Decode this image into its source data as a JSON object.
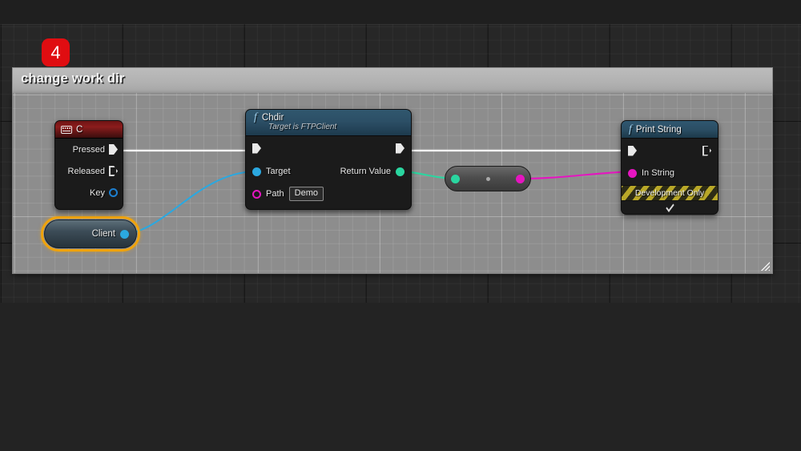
{
  "badge": {
    "number": "4"
  },
  "comment": {
    "title": "change work dir",
    "resize_handle_name": "resize-handle"
  },
  "colors": {
    "exec_white": "#e9e9e9",
    "object_blue": "#2ba8e0",
    "string_magenta": "#e515c0",
    "boolean_green": "#2ad6a0",
    "badge_red": "#e00d11",
    "selection_orange": "#f0a30a",
    "comment_bar": "#b2b2b2",
    "comment_body": "#8d8d8d"
  },
  "nodes": {
    "keyboard_event": {
      "icon": "keyboard-icon",
      "title": "C",
      "pins": [
        {
          "label": "Pressed",
          "type": "exec",
          "filled": true
        },
        {
          "label": "Released",
          "type": "exec",
          "filled": false
        },
        {
          "label": "Key",
          "type": "data",
          "color": "#1d7fd0"
        }
      ]
    },
    "chdir": {
      "icon": "function-icon",
      "title": "Chdir",
      "subtitle": "Target is FTPClient",
      "exec_in": "",
      "exec_out": "",
      "inputs": [
        {
          "label": "Target",
          "color": "#2ba8e0",
          "style": "filled"
        },
        {
          "label": "Path",
          "color": "#e515c0",
          "style": "ring",
          "value": "Demo"
        }
      ],
      "outputs": [
        {
          "label": "Return Value",
          "color": "#2ad6a0",
          "style": "filled"
        }
      ]
    },
    "convert_knot": {
      "name": "convert-bool-to-string-node",
      "input_color": "#2ad6a0",
      "output_color": "#e515c0"
    },
    "print_string": {
      "icon": "function-icon",
      "title": "Print String",
      "inputs": [
        {
          "label": "In String",
          "color": "#e515c0",
          "style": "filled"
        }
      ],
      "dev_band_label": "Development Only",
      "expander": "chevron-down-icon"
    },
    "client_variable": {
      "label": "Client",
      "pin_color": "#2ba8e0",
      "selected": true
    }
  }
}
